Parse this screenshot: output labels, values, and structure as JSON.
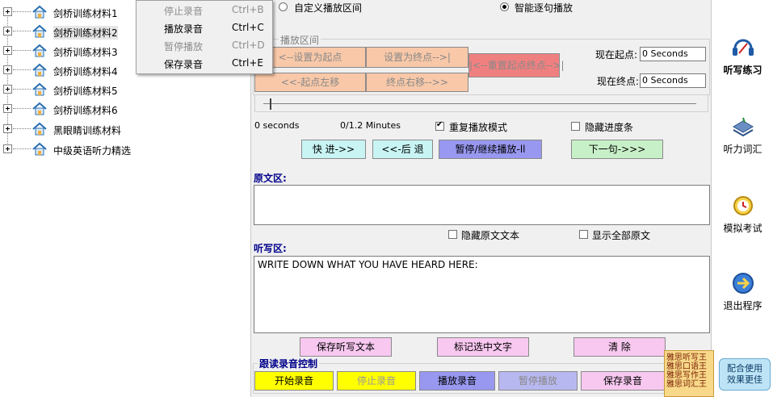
{
  "tree": {
    "items": [
      {
        "label": "剑桥训练材料1"
      },
      {
        "label": "剑桥训练材料2"
      },
      {
        "label": "剑桥训练材料3"
      },
      {
        "label": "剑桥训练材料4"
      },
      {
        "label": "剑桥训练材料5"
      },
      {
        "label": "剑桥训练材料6"
      },
      {
        "label": "黑眼睛训练材料"
      },
      {
        "label": "中级英语听力精选"
      }
    ]
  },
  "context_menu": {
    "items": [
      {
        "label": "停止录音",
        "shortcut": "Ctrl+B",
        "enabled": false
      },
      {
        "label": "播放录音",
        "shortcut": "Ctrl+C",
        "enabled": true
      },
      {
        "label": "暂停播放",
        "shortcut": "Ctrl+D",
        "enabled": false
      },
      {
        "label": "保存录音",
        "shortcut": "Ctrl+E",
        "enabled": true
      }
    ]
  },
  "playback_mode": {
    "custom_label": "自定义播放区间",
    "smart_label": "智能逐句播放",
    "selected": "smart"
  },
  "interval": {
    "group_title": "播放区间",
    "set_start": "<--设置为起点",
    "set_end": "设置为终点-->|",
    "reset": "|<--重置起点终点-->|",
    "start_left": "<<-起点左移",
    "end_right": "终点右移-->>",
    "current_start_label": "现在起点:",
    "current_start_value": "0 Seconds",
    "current_end_label": "现在终点:",
    "current_end_value": "0 Seconds"
  },
  "progress": {
    "position_text": "0 seconds",
    "duration_text": "0/1.2 Minutes",
    "fraction": 0,
    "repeat_label": "重复播放模式",
    "repeat_checked": true,
    "hide_progress_label": "隐藏进度条",
    "hide_progress_checked": false
  },
  "controls": {
    "forward": "快 进->>",
    "back": "<<-后 退",
    "pause": "暂停/继续播放-ll",
    "next": "下一句->>>"
  },
  "original": {
    "section_title": "原文区:",
    "text": "",
    "hide_label": "隐藏原文文本",
    "show_all_label": "显示全部原文"
  },
  "dictation": {
    "section_title": "听写区:",
    "text": "WRITE DOWN WHAT YOU HAVE HEARD HERE:",
    "save": "保存听写文本",
    "mark": "标记选中文字",
    "clear": "清 除"
  },
  "recording": {
    "group_title": "跟读录音控制",
    "start": "开始录音",
    "stop": "停止录音",
    "play": "播放录音",
    "pause": "暂停播放",
    "save": "保存录音"
  },
  "sidebar": {
    "items": [
      {
        "label": "听写练习",
        "icon": "dictation-icon",
        "active": true
      },
      {
        "label": "听力词汇",
        "icon": "vocabulary-icon",
        "active": false
      },
      {
        "label": "模拟考试",
        "icon": "exam-clock-icon",
        "active": false
      },
      {
        "label": "退出程序",
        "icon": "exit-arrow-icon",
        "active": false
      }
    ]
  },
  "ads": {
    "banner_lines": [
      "雅思听写王",
      "雅思口语王",
      "雅思写作王",
      "雅思词汇王"
    ],
    "promo_line1": "配合使用",
    "promo_line2": "效果更佳"
  },
  "colors": {
    "peach": "#f8c8a8",
    "red_button": "#f08080",
    "cyan_button": "#c8f4f4",
    "purple_button": "#9898f0",
    "green_button": "#c8f0c8",
    "pink_button": "#f8c8f0",
    "yellow_button": "#ffff00",
    "section_blue": "#00008b"
  }
}
